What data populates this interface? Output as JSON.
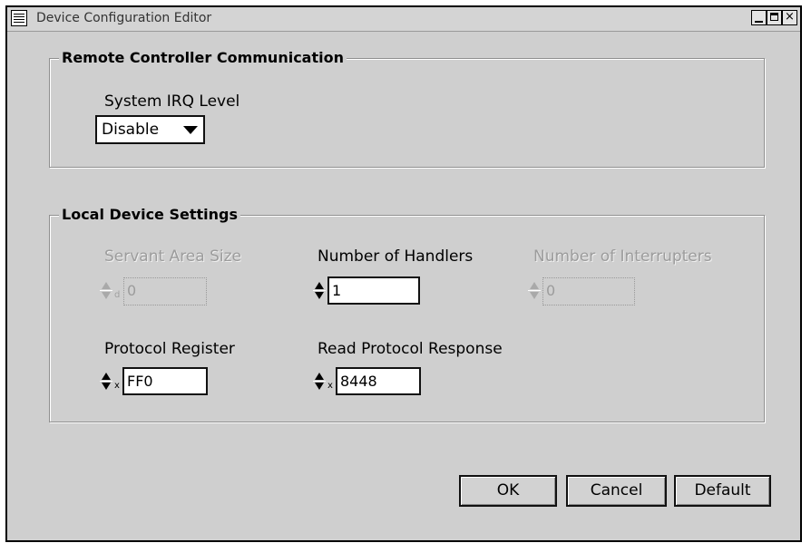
{
  "window": {
    "title": "Device Configuration Editor",
    "controls": {
      "minimize": "minimize",
      "maximize": "maximize",
      "close": "×"
    }
  },
  "remote_group": {
    "title": "Remote Controller Communication",
    "irq_label": "System IRQ Level",
    "irq_value": "Disable"
  },
  "local_group": {
    "title": "Local Device Settings",
    "servant_area_size": {
      "label": "Servant Area Size",
      "value": "0",
      "enabled": false
    },
    "number_of_handlers": {
      "label": "Number of Handlers",
      "value": "1",
      "enabled": true
    },
    "number_of_interrupters": {
      "label": "Number of Interrupters",
      "value": "0",
      "enabled": false
    },
    "protocol_register": {
      "label": "Protocol Register",
      "value": "FF0",
      "enabled": true,
      "radix_mark": "x"
    },
    "read_protocol_response": {
      "label": "Read Protocol Response",
      "value": "8448",
      "enabled": true,
      "radix_mark": "x"
    },
    "servant_radix_mark": "d"
  },
  "buttons": {
    "ok": "OK",
    "cancel": "Cancel",
    "default": "Default"
  }
}
